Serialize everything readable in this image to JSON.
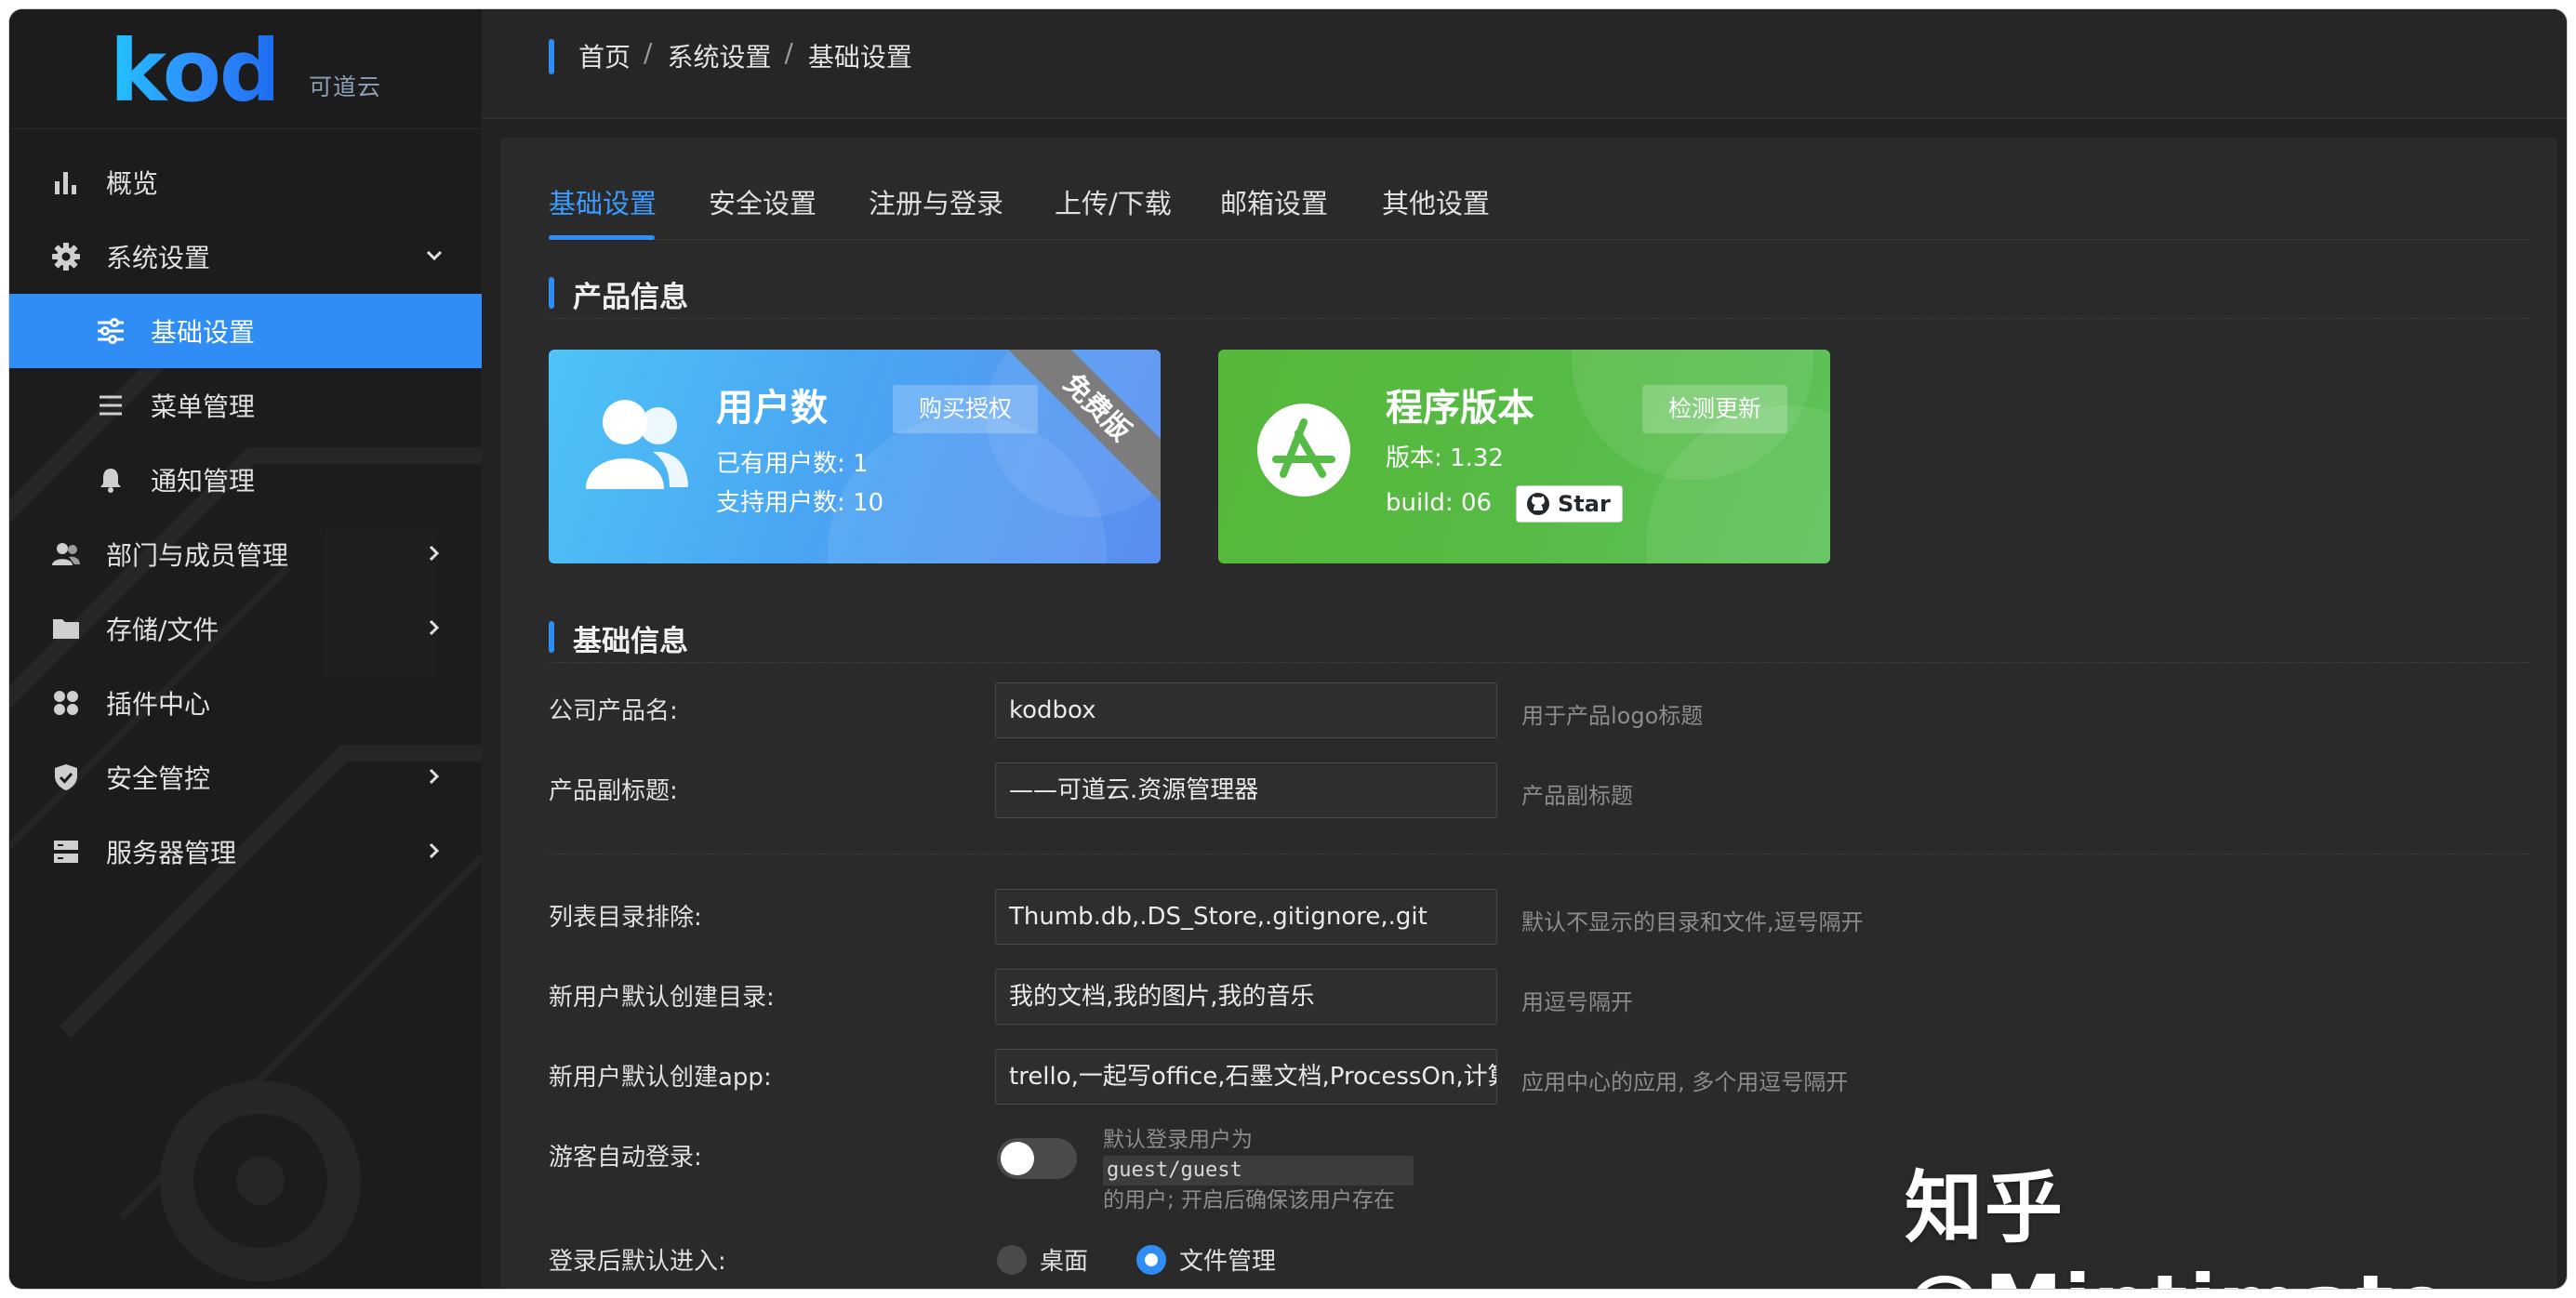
{
  "logo": {
    "brand": "kod",
    "sub": "可道云"
  },
  "sidebar": {
    "items": [
      {
        "label": "概览",
        "icon": "bar-chart-icon"
      },
      {
        "label": "系统设置",
        "icon": "gear-icon",
        "expanded": true
      },
      {
        "label": "基础设置",
        "icon": "sliders-icon",
        "active": true
      },
      {
        "label": "菜单管理",
        "icon": "list-icon"
      },
      {
        "label": "通知管理",
        "icon": "bell-icon"
      },
      {
        "label": "部门与成员管理",
        "icon": "users-icon"
      },
      {
        "label": "存储/文件",
        "icon": "folder-icon"
      },
      {
        "label": "插件中心",
        "icon": "apps-icon"
      },
      {
        "label": "安全管控",
        "icon": "shield-icon"
      },
      {
        "label": "服务器管理",
        "icon": "server-icon"
      }
    ]
  },
  "breadcrumb": {
    "home": "首页",
    "sep": "/",
    "level1": "系统设置",
    "level2": "基础设置"
  },
  "tabs": [
    "基础设置",
    "安全设置",
    "注册与登录",
    "上传/下载",
    "邮箱设置",
    "其他设置"
  ],
  "sections": {
    "product": "产品信息",
    "basic": "基础信息"
  },
  "cards": {
    "users": {
      "title": "用户数",
      "button": "购买授权",
      "ribbon": "免费版",
      "existing_label": "已有用户数:",
      "existing_value": "1",
      "supported_label": "支持用户数:",
      "supported_value": "10",
      "color": "#4aa6f3"
    },
    "version": {
      "title": "程序版本",
      "button": "检测更新",
      "version_label": "版本:",
      "version_value": "1.32",
      "build_label": "build:",
      "build_value": "06",
      "star": "Star",
      "color": "#56bb44"
    }
  },
  "form": {
    "company_name": {
      "label": "公司产品名:",
      "value": "kodbox",
      "hint": "用于产品logo标题"
    },
    "subtitle": {
      "label": "产品副标题:",
      "value": "——可道云.资源管理器",
      "hint": "产品副标题"
    },
    "exclude": {
      "label": "列表目录排除:",
      "value": "Thumb.db,.DS_Store,.gitignore,.git",
      "hint": "默认不显示的目录和文件,逗号隔开"
    },
    "default_dirs": {
      "label": "新用户默认创建目录:",
      "value": "我的文档,我的图片,我的音乐",
      "hint": "用逗号隔开"
    },
    "default_apps": {
      "label": "新用户默认创建app:",
      "value": "trello,一起写office,石墨文档,ProcessOn,计算器",
      "hint": "应用中心的应用, 多个用逗号隔开"
    },
    "guest_login": {
      "label": "游客自动登录:",
      "enabled": false,
      "hint_top": "默认登录用户为",
      "hint_code": "guest/guest",
      "hint_bottom": "的用户; 开启后确保该用户存在"
    },
    "after_login": {
      "label": "登录后默认进入:",
      "options": [
        "桌面",
        "文件管理"
      ],
      "selected": "文件管理"
    }
  },
  "watermark": "知乎 @Mintimate",
  "colors": {
    "accent": "#2f8df5",
    "sidebar_bg": "#1c1c1c",
    "main_bg": "#2a2a2a"
  }
}
